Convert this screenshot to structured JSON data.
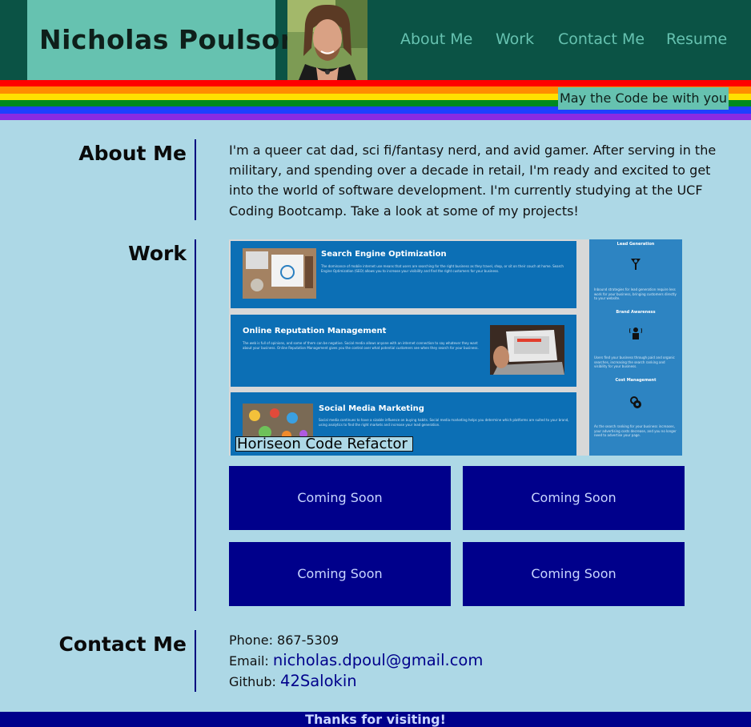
{
  "header": {
    "name": "Nicholas Poulson",
    "nav": [
      "About Me",
      "Work",
      "Contact Me",
      "Resume"
    ],
    "tagline": "May the Code be with you"
  },
  "about": {
    "title": "About Me",
    "text": "I'm a queer cat dad, sci fi/fantasy nerd, and avid gamer. After serving in the military, and spending over a decade in retail, I'm ready and excited to get into the world of software development. I'm currently studying at the UCF Coding Bootcamp. Take a look at some of my projects!"
  },
  "work": {
    "title": "Work",
    "featured": {
      "caption": "Horiseon Code Refactor",
      "panels": [
        "Search Engine Optimization",
        "Online Reputation Management",
        "Social Media Marketing"
      ],
      "panel_texts": [
        "The dominance of mobile internet use means that users are searching for the right business as they travel, shop, or sit on their couch at home. Search Engine Optimization (SEO) allows you to increase your visibility and find the right customers for your business.",
        "The web is full of opinions, and some of them can be negative. Social media allows anyone with an internet connection to say whatever they want about your business. Online Reputation Management gives you the control over what potential customers see when they search for your business.",
        "Social media continues to have a sizable influence on buying habits. Social media marketing helps you determine which platforms are suited to your brand, using analytics to find the right markets and increase your lead generation."
      ],
      "sidebar": [
        {
          "title": "Lead Generation",
          "text": "Inbound strategies for lead generation require less work for your business, bringing customers directly to your website."
        },
        {
          "title": "Brand Awareness",
          "text": "Users find your business through paid and organic searches, increasing the search ranking and visibility for your business."
        },
        {
          "title": "Cost Management",
          "text": "As the search ranking for your business increases, your advertising costs decrease, and you no longer need to advertise your page."
        }
      ]
    },
    "placeholders": [
      "Coming Soon",
      "Coming Soon",
      "Coming Soon",
      "Coming Soon"
    ]
  },
  "contact": {
    "title": "Contact Me",
    "phone_label": "Phone:",
    "phone": "867-5309",
    "email_label": "Email:",
    "email": "nicholas.dpoul@gmail.com",
    "github_label": "Github:",
    "github": "42Salokin"
  },
  "footer": {
    "text": "Thanks for visiting!"
  },
  "colors": {
    "header_bg": "#0b5345",
    "accent": "#66c2b0",
    "page_bg": "#add8e6",
    "card_bg": "#00008b",
    "rainbow": [
      "#ff0000",
      "#ff8c00",
      "#ffe000",
      "#008a20",
      "#1f3fff",
      "#8a2be2"
    ]
  }
}
